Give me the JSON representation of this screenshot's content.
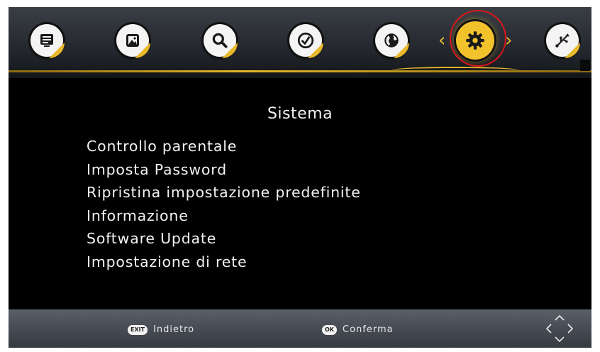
{
  "menu_bar": {
    "icons": [
      {
        "name": "program-guide-icon",
        "active": false
      },
      {
        "name": "picture-icon",
        "active": false
      },
      {
        "name": "search-icon",
        "active": false
      },
      {
        "name": "time-icon",
        "active": false
      },
      {
        "name": "globe-icon",
        "active": false
      },
      {
        "name": "gear-icon",
        "active": true
      },
      {
        "name": "usb-icon",
        "active": false
      }
    ],
    "accent_color": "#e8b92a",
    "highlight_color": "#e0151b"
  },
  "content": {
    "title": "Sistema",
    "items": [
      "Controllo parentale",
      "Imposta Password",
      "Ripristina impostazione predefinite",
      "Informazione",
      "Software Update",
      "Impostazione di rete"
    ]
  },
  "footer": {
    "exit_key": "EXIT",
    "exit_label": "Indietro",
    "ok_key": "OK",
    "ok_label": "Conferma",
    "dpad_icon": "dpad-arrows-icon"
  }
}
